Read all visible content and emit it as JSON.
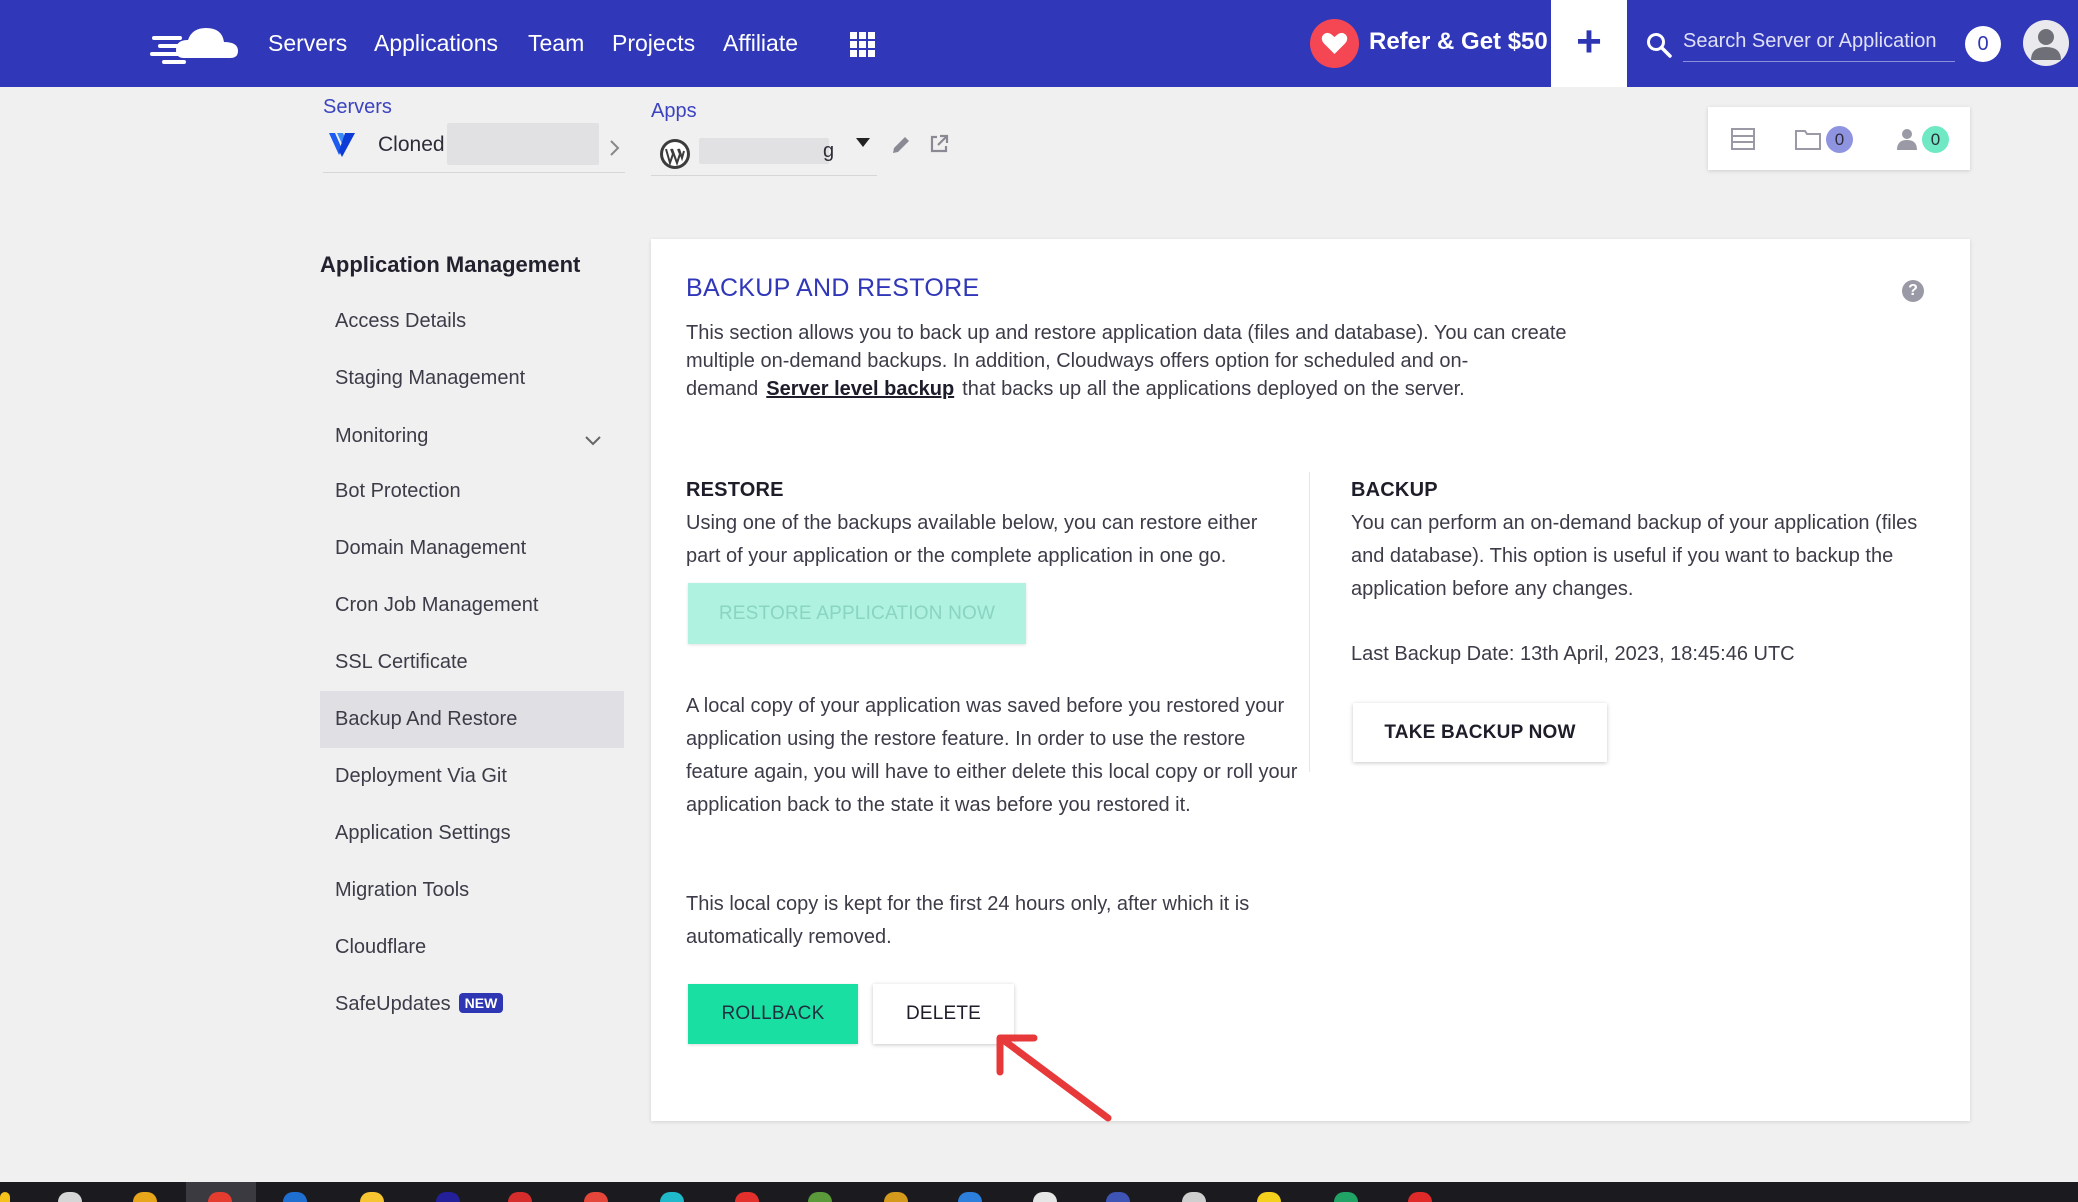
{
  "topbar": {
    "nav": [
      "Servers",
      "Applications",
      "Team",
      "Projects",
      "Affiliate"
    ],
    "refer_label": "Refer & Get $50",
    "add_symbol": "+",
    "search_placeholder": "Search Server or Application",
    "notifications_count": "0",
    "colors": {
      "bar": "#3037b8",
      "heart": "#f44753"
    }
  },
  "breadcrumb": {
    "servers_title": "Servers",
    "server_name": "Cloned",
    "apps_title": "Apps",
    "app_name_suffix": "g"
  },
  "status_card": {
    "files_count": "0",
    "users_count": "0",
    "colors": {
      "files_badge": "#8f94e0",
      "users_badge": "#6fe8c4"
    }
  },
  "sidebar": {
    "heading": "Application Management",
    "items": [
      "Access Details",
      "Staging Management",
      "Monitoring",
      "Bot Protection",
      "Domain Management",
      "Cron Job Management",
      "SSL Certificate",
      "Backup And Restore",
      "Deployment Via Git",
      "Application Settings",
      "Migration Tools",
      "Cloudflare",
      "SafeUpdates"
    ],
    "active_item": "Backup And Restore",
    "new_badge": "NEW"
  },
  "main": {
    "title": "BACKUP AND RESTORE",
    "help": "?",
    "intro_part1": "This section allows you to back up and restore application data (files and database). You can create multiple on-demand backups. In addition, Cloudways offers option for scheduled and on-demand",
    "intro_link": "Server level backup",
    "intro_part2": "that backs up all the applications deployed on the server.",
    "restore": {
      "title": "RESTORE",
      "desc": "Using one of the backups available below, you can restore either part of your application or the complete application in one go.",
      "button": "RESTORE APPLICATION NOW",
      "local_copy_text": "A local copy of your application was saved before you restored your application using the restore feature. In order to use the restore feature again, you will have to either delete this local copy or roll your application back to the state it was before you restored it.",
      "retention_text": "This local copy is kept for the first 24 hours only, after which it is automatically removed.",
      "rollback_button": "ROLLBACK",
      "delete_button": "DELETE"
    },
    "backup": {
      "title": "BACKUP",
      "desc": "You can perform an on-demand backup of your application (files and database). This option is useful if you want to backup the application before any changes.",
      "last_backup": "Last Backup Date: 13th April, 2023, 18:45:46 UTC",
      "button": "TAKE BACKUP NOW"
    },
    "colors": {
      "accent": "#3037b8",
      "rollback": "#19e0a2",
      "restore_disabled": "#aef2df",
      "arrow": "#e8393a"
    }
  }
}
